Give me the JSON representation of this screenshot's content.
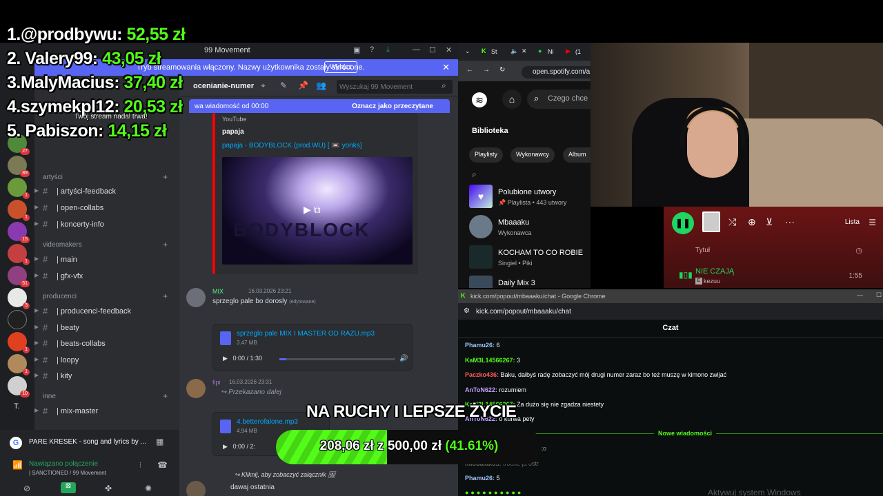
{
  "leaderboard": [
    {
      "rank": "1.",
      "name": "@prodbywu:",
      "amount": "52,55 zł"
    },
    {
      "rank": "2.",
      "name": "Valery99:",
      "amount": "43,05 zł"
    },
    {
      "rank": "3.",
      "name": "MalyMacius:",
      "amount": "37,40 zł"
    },
    {
      "rank": "4.",
      "name": "szymekpl12:",
      "amount": "20,53 zł"
    },
    {
      "rank": "5.",
      "name": "Pabiszon:",
      "amount": "14,15 zł"
    }
  ],
  "stream_note": "Twój stream nadal trwa!",
  "discord": {
    "window_title": "99 Movement",
    "banner": {
      "text": "Tryb streamowania włączony. Nazwy użytkownika zostały skrócone.",
      "button": "Wyłącz"
    },
    "channel_name": "ocenianie-numer",
    "search_placeholder": "Wyszukaj 99 Movement",
    "new_messages": {
      "text": "wa wiadomość od 00:00",
      "action": "Oznacz jako przeczytane"
    },
    "categories": [
      {
        "label": "artyści",
        "channels": [
          "| artyści-feedback",
          "| open-collabs",
          "| koncerty-info"
        ]
      },
      {
        "label": "videomakers",
        "channels": [
          "| main",
          "| gfx-vfx"
        ]
      },
      {
        "label": "producenci",
        "channels": [
          "| producenci-feedback",
          "| beaty",
          "| beats-collabs",
          "| loopy",
          "| kity"
        ]
      },
      {
        "label": "inne",
        "channels": [
          "| mix-master"
        ]
      }
    ],
    "server_badges": [
      "27",
      "89",
      "1",
      "1",
      "15",
      "1",
      "51",
      "3",
      "1",
      "1",
      "10"
    ],
    "embed": {
      "provider": "YouTube",
      "author": "papaja",
      "title": "papaja - BODYBLOCK (prod.WU) [ 📼 yonks]",
      "thumb_text": "BODYBLOCK"
    },
    "message1": {
      "user": "MIX",
      "timestamp": "16.03.2026 23:21",
      "text": "sprzeglo pale bo dorosly",
      "edited": "(edytowane)"
    },
    "attachment1": {
      "name": "sprzeglo pale MIX I MASTER OD RAZU.mp3",
      "size": "3.47 MB",
      "time": "0:00 / 1:30"
    },
    "message2": {
      "user": "fipi",
      "timestamp": "16.03.2026 23:31",
      "text": "Przekazano dalej"
    },
    "attachment2": {
      "name": "4.betterofalone.mp3",
      "size": "4.94 MB",
      "time": "0:00 / 2:"
    },
    "message3": {
      "text": "Kliknij, aby zobaczyć załącznik",
      "reply": "dawaj ostatnia"
    },
    "now_playing": "PARE KRESEK - song and lyrics by ...",
    "voice": {
      "status": "Nawiązano połączenie",
      "channel": "| SANCTIONED / 99 Movement"
    }
  },
  "spotify": {
    "tab_labels": [
      "St",
      "Ni",
      "(1"
    ],
    "url": "open.spotify.com/a",
    "search": "Czego chce",
    "library_title": "Biblioteka",
    "chips": [
      "Playlisty",
      "Wykonawcy",
      "Album"
    ],
    "items": [
      {
        "title": "Polubione utwory",
        "sub": "Playlista • 443 utwory"
      },
      {
        "title": "Mbaaaku",
        "sub": "Wykonawca"
      },
      {
        "title": "KOCHAM TO CO ROBIE",
        "sub": "Singiel • Piki"
      },
      {
        "title": "Daily Mix 3",
        "sub": ""
      }
    ],
    "player": {
      "lista": "Lista",
      "col_title": "Tytuł",
      "track": "NIE CZAJĄ",
      "artist": "kezuu",
      "duration": "1:55"
    }
  },
  "kick": {
    "window_title": "kick.com/popout/mbaaaku/chat - Google Chrome",
    "url": "kick.com/popout/mbaaaku/chat",
    "heading": "Czat",
    "messages": [
      {
        "user": "Phamu26:",
        "text": " 6",
        "color": "#9ec5ff"
      },
      {
        "user": "KaM3L14566267:",
        "text": " 3",
        "color": "#53fc18"
      },
      {
        "user": "Paczko436:",
        "text": " Baku, dałbyś radę zobaczyć mój drugi numer zaraz bo też muszę w kimono zwijać",
        "color": "#ff5a5a"
      },
      {
        "user": "AnToN622:",
        "text": " rozumiem",
        "color": "#c4a0ff"
      },
      {
        "user": "KaM3L14566267:",
        "text": " Za dużo się nie zgadza niestety",
        "color": "#53fc18"
      },
      {
        "user": "AnToN622:",
        "text": " o kurwa pety",
        "color": "#c4a0ff"
      },
      {
        "user": "",
        "text": "To jest to",
        "color": "#9a9a9a"
      },
      {
        "user": "mlodalakos:",
        "text": " troche ja ostr",
        "color": "#6a6a6a"
      },
      {
        "user": "Phamu26:",
        "text": " 5",
        "color": "#9ec5ff"
      }
    ],
    "new_divider": "Nowe wiadomości",
    "windows_watermark": "Aktywuj system Windows"
  },
  "subtitle": "NA RUCHY I LEPSZE ŻYCIE",
  "goal": {
    "current": "208,06 zł",
    "sep": "z",
    "target": "500,00 zł",
    "percent_label": "(41.61%)",
    "fraction": 0.4161
  }
}
